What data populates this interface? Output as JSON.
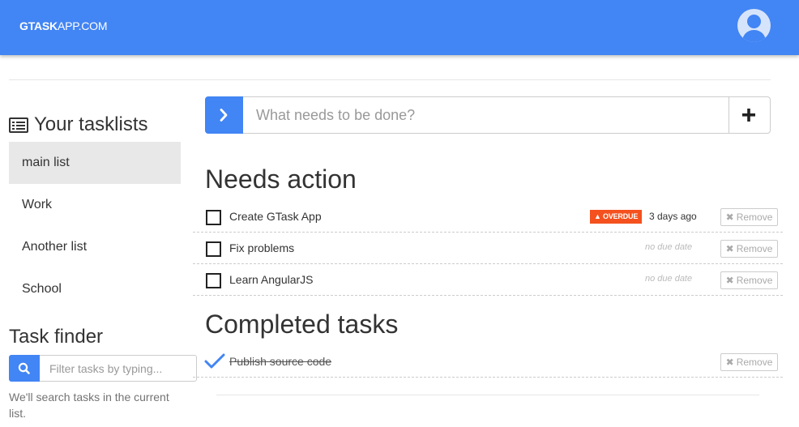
{
  "header": {
    "brand_bold": "GTASK",
    "brand_rest": "APP.COM",
    "avatar_icon": "user-avatar-icon",
    "color": "#4285f4"
  },
  "sidebar": {
    "title": "Your tasklists",
    "items": [
      {
        "label": "main list",
        "active": true
      },
      {
        "label": "Work",
        "active": false
      },
      {
        "label": "Another list",
        "active": false
      },
      {
        "label": "School",
        "active": false
      }
    ],
    "finder_title": "Task finder",
    "finder_placeholder": "Filter tasks by typing...",
    "finder_help": "We'll search tasks in the current list."
  },
  "new_task": {
    "placeholder": "What needs to be done?",
    "add_icon": "plus-icon",
    "go_icon": "chevron-right-icon"
  },
  "needs_action": {
    "title": "Needs action",
    "tasks": [
      {
        "name": "Create GTask App",
        "badge": "OVERDUE",
        "due": "3 days ago",
        "remove": "Remove"
      },
      {
        "name": "Fix problems",
        "due_none": "no due date",
        "remove": "Remove"
      },
      {
        "name": "Learn AngularJS",
        "due_none": "no due date",
        "remove": "Remove"
      }
    ]
  },
  "completed": {
    "title": "Completed tasks",
    "tasks": [
      {
        "name": "Publish source code",
        "remove": "Remove"
      }
    ]
  }
}
